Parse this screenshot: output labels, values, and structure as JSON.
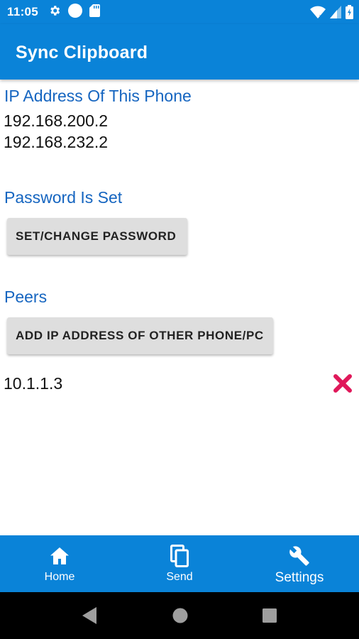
{
  "status_bar": {
    "time": "11:05",
    "left_icons": [
      "gear-icon",
      "circle-icon",
      "sd-card-icon"
    ],
    "right_icons": [
      "wifi-icon",
      "signal-icon",
      "battery-icon"
    ]
  },
  "app_bar": {
    "title": "Sync Clipboard"
  },
  "ip_section": {
    "title": "IP Address Of This Phone",
    "addresses": [
      "192.168.200.2",
      "192.168.232.2"
    ]
  },
  "password_section": {
    "title": "Password Is Set",
    "button_label": "SET/CHANGE PASSWORD"
  },
  "peers_section": {
    "title": "Peers",
    "button_label": "ADD IP ADDRESS OF OTHER PHONE/PC",
    "peers": [
      {
        "ip": "10.1.1.3",
        "remove_icon": "close-icon"
      }
    ]
  },
  "bottom_nav": {
    "items": [
      {
        "label": "Home",
        "icon": "home-icon"
      },
      {
        "label": "Send",
        "icon": "copy-icon"
      },
      {
        "label": "Settings",
        "icon": "wrench-icon",
        "active": true
      }
    ]
  },
  "system_nav": {
    "icons": [
      "back-icon",
      "home-circle-icon",
      "recents-icon"
    ]
  },
  "colors": {
    "primary": "#0a83d8",
    "section_title": "#1565c0",
    "remove": "#e0185a",
    "button_bg": "#dedede"
  }
}
